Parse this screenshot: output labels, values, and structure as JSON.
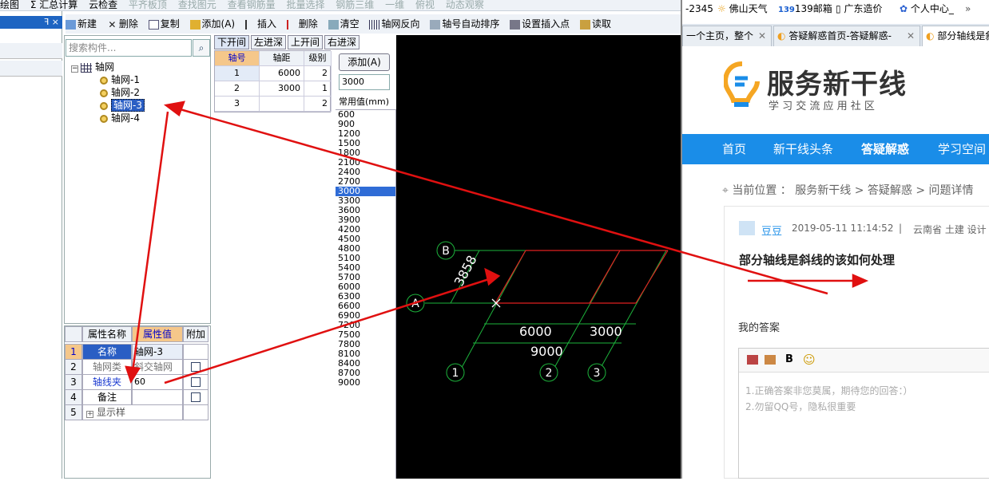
{
  "toolbar1": {
    "items": [
      "绘图",
      "Σ 汇总计算",
      "云检查",
      "平齐板顶",
      "查找图元",
      "查看钢筋量",
      "批量选择",
      "钢筋三维",
      "一维",
      "俯视",
      "动态观察"
    ]
  },
  "toolbar2": {
    "items": [
      "新建",
      "删除",
      "复制",
      "添加(A)",
      "插入",
      "删除",
      "清空",
      "轴网反向",
      "轴号自动排序",
      "设置插入点",
      "读取"
    ]
  },
  "left_strip": {
    "pin": "ꟻ ×"
  },
  "tree": {
    "search_placeholder": "搜索构件...",
    "root": "轴网",
    "children": [
      "轴网-1",
      "轴网-2",
      "轴网-3",
      "轴网-4"
    ],
    "selected": "轴网-3"
  },
  "props": {
    "headers": [
      "属性名称",
      "属性值",
      "附加"
    ],
    "rows": [
      {
        "n": "1",
        "name": "名称",
        "value": "轴网-3",
        "extra": ""
      },
      {
        "n": "2",
        "name": "轴网类",
        "value": "斜交轴网",
        "extra": "box"
      },
      {
        "n": "3",
        "name": "轴线夹",
        "value": "60",
        "extra": "box"
      },
      {
        "n": "4",
        "name": "备注",
        "value": "",
        "extra": "box"
      },
      {
        "n": "5",
        "name": "显示样",
        "value": "",
        "extra": ""
      }
    ]
  },
  "axis_tabs": [
    "下开间",
    "左进深",
    "上开间",
    "右进深"
  ],
  "axis_table": {
    "headers": [
      "轴号",
      "轴距",
      "级别"
    ],
    "rows": [
      [
        "1",
        "6000",
        "2"
      ],
      [
        "2",
        "3000",
        "1"
      ],
      [
        "3",
        "",
        "2"
      ]
    ]
  },
  "add_panel": {
    "add_label": "添加(A)",
    "value": "3000",
    "common_label": "常用值(mm)"
  },
  "common_values": [
    "600",
    "900",
    "1200",
    "1500",
    "1800",
    "2100",
    "2400",
    "2700",
    "3000",
    "3300",
    "3600",
    "3900",
    "4200",
    "4500",
    "4800",
    "5100",
    "5400",
    "5700",
    "6000",
    "6300",
    "6600",
    "6900",
    "7200",
    "7500",
    "7800",
    "8100",
    "8400",
    "8700",
    "9000"
  ],
  "common_selected": "3000",
  "cad": {
    "axis_labels": [
      "B",
      "A",
      "1",
      "2",
      "3"
    ],
    "dims": [
      "3858",
      "6000",
      "3000",
      "9000"
    ],
    "colors": {
      "grid": "#1db33c",
      "axis": "#e02020",
      "dim": "#ffffff"
    }
  },
  "browser": {
    "bookmarks": [
      "-2345",
      "佛山天气",
      "139邮箱",
      "广东造价",
      "个人中心_"
    ],
    "tabs": [
      "一个主页，整个",
      "答疑解惑首页-答疑解惑-",
      "部分轴线是斜"
    ],
    "logo_title": "服务新干线",
    "logo_sub": "学 习 交 流 应 用 社 区",
    "nav": [
      "首页",
      "新干线头条",
      "答疑解惑",
      "学习空间"
    ],
    "breadcrumb_prefix": "当前位置 ：",
    "breadcrumb": "服务新干线 > 答疑解惑 > 问题详情",
    "post_user": "豆豆",
    "post_time": "2019-05-11 11:14:52",
    "post_sep": "|",
    "post_region": "云南省  土建 设计",
    "post_title": "部分轴线是斜线的该如何处理",
    "my_answer": "我的答案",
    "tip1": "1.正确答案非您莫属，期待您的回答：）",
    "tip2": "2.勿留QQ号，隐私很重要"
  }
}
